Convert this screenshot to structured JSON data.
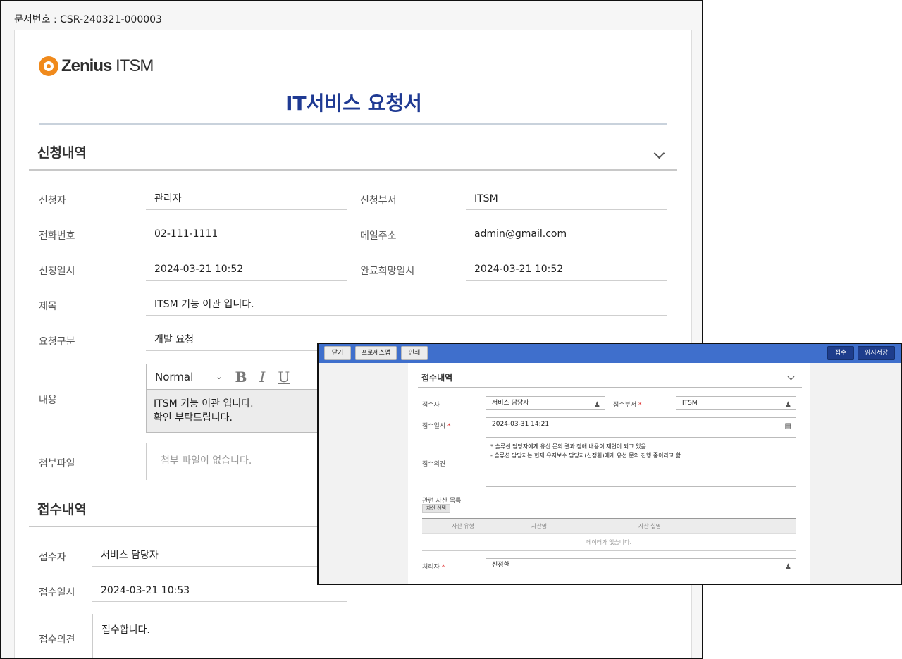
{
  "document": {
    "doc_number": "문서번호 : CSR-240321-000003",
    "logo_brand": "Zenius",
    "logo_product": "ITSM",
    "title": "IT서비스 요청서"
  },
  "request_section": {
    "heading": "신청내역",
    "fields": {
      "requester_label": "신청자",
      "requester_value": "관리자",
      "department_label": "신청부서",
      "department_value": "ITSM",
      "phone_label": "전화번호",
      "phone_value": "02-111-1111",
      "email_label": "메일주소",
      "email_value": "admin@gmail.com",
      "request_date_label": "신청일시",
      "request_date_value": "2024-03-21 10:52",
      "due_date_label": "완료희망일시",
      "due_date_value": "2024-03-21 10:52",
      "subject_label": "제목",
      "subject_value": "ITSM 기능 이관 입니다.",
      "type_label": "요청구분",
      "type_value": "개발 요청",
      "content_label": "내용",
      "attach_label": "첨부파일",
      "attach_value": "첨부 파일이 없습니다."
    },
    "editor": {
      "format": "Normal",
      "bold": "B",
      "italic": "I",
      "underline": "U",
      "line1": "ITSM 기능 이관 입니다.",
      "line2": "확인 부탁드립니다."
    }
  },
  "receipt_section": {
    "heading": "접수내역",
    "receiver_label": "접수자",
    "receiver_value": "서비스 담당자",
    "receipt_date_label": "접수일시",
    "receipt_date_value": "2024-03-21 10:53",
    "opinion_label": "접수의견",
    "opinion_value": "접수합니다."
  },
  "popup": {
    "buttons": {
      "close": "닫기",
      "process_map": "프로세스맵",
      "print": "인쇄",
      "receive": "접수",
      "temp_save": "임시저장"
    },
    "heading": "접수내역",
    "receiver_label": "접수자",
    "receiver_value": "서비스 담당자",
    "dept_label": "접수부서",
    "dept_value": "ITSM",
    "date_label": "접수일시",
    "date_value": "2024-03-31 14:21",
    "opinion_label": "접수의견",
    "opinion_line1": "* 솔류션 담당자에게 유선 문의 결과 장애 내용이 재현이 되고 있음.",
    "opinion_line2": "- 솔류션 담당자는 현재 유지보수 담당자(신정환)에게 유선 문의 진행 중이라고 함.",
    "asset_title": "관련 자산 목록",
    "asset_button": "자산 선택",
    "grid_headers": [
      "자산 유형",
      "자산명",
      "자산 설명"
    ],
    "no_data": "데이터가 없습니다.",
    "handler_label": "처리자",
    "handler_value": "신정환",
    "required_mark": "*"
  },
  "colors": {
    "title_blue": "#1f3a93",
    "topbar_blue": "#3f6fcc",
    "dark_button": "#1e3d8c",
    "logo_orange": "#f08a1c"
  }
}
